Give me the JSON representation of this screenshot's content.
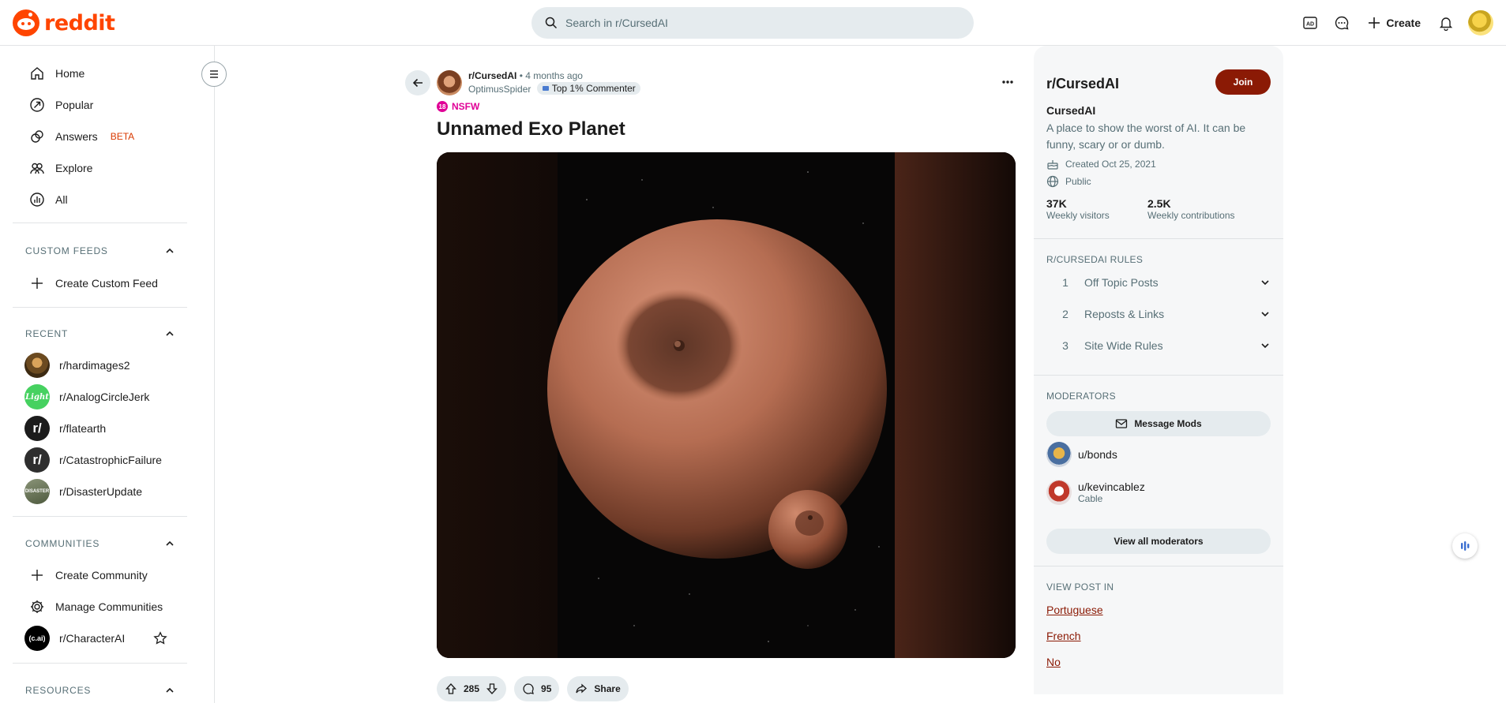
{
  "header": {
    "brand": "reddit",
    "search_placeholder": "Search in r/CursedAI",
    "create_label": "Create"
  },
  "sidebar": {
    "nav": [
      {
        "label": "Home",
        "icon": "home-icon"
      },
      {
        "label": "Popular",
        "icon": "popular-icon"
      },
      {
        "label": "Answers",
        "badge": "BETA",
        "icon": "answers-icon"
      },
      {
        "label": "Explore",
        "icon": "explore-icon"
      },
      {
        "label": "All",
        "icon": "all-icon"
      }
    ],
    "custom_feeds": {
      "title": "CUSTOM FEEDS",
      "create": "Create Custom Feed"
    },
    "recent": {
      "title": "RECENT",
      "items": [
        {
          "label": "r/hardimages2",
          "color": "#7a5a2e"
        },
        {
          "label": "r/AnalogCircleJerk",
          "color": "#46d160",
          "icon_text": "Light"
        },
        {
          "label": "r/flatearth",
          "color": "#1c1c1c",
          "icon_text": "r/"
        },
        {
          "label": "r/CatastrophicFailure",
          "color": "#2a2a2a",
          "icon_text": "r/"
        },
        {
          "label": "r/DisasterUpdate",
          "color": "#5b6b4e",
          "icon_text": "DISASTER"
        }
      ]
    },
    "communities": {
      "title": "COMMUNITIES",
      "create": "Create Community",
      "manage": "Manage Communities",
      "items": [
        {
          "label": "r/CharacterAI",
          "icon_text": "(c.ai)"
        }
      ]
    },
    "resources": {
      "title": "RESOURCES"
    }
  },
  "post": {
    "subreddit": "r/CursedAI",
    "time": "• 4 months ago",
    "author": "OptimusSpider",
    "author_flair": "Top 1% Commenter",
    "nsfw_badge": "18",
    "nsfw_label": "NSFW",
    "title": "Unnamed Exo Planet",
    "votes": "285",
    "comments": "95",
    "share_label": "Share"
  },
  "about": {
    "title": "r/CursedAI",
    "join_label": "Join",
    "name": "CursedAI",
    "description": "A place to show the worst of AI. It can be funny, scary or or dumb.",
    "created": "Created Oct 25, 2021",
    "visibility": "Public",
    "stats": [
      {
        "value": "37K",
        "label": "Weekly visitors"
      },
      {
        "value": "2.5K",
        "label": "Weekly contributions"
      }
    ],
    "rules_title": "R/CURSEDAI RULES",
    "rules": [
      {
        "num": "1",
        "text": "Off Topic Posts"
      },
      {
        "num": "2",
        "text": "Reposts & Links"
      },
      {
        "num": "3",
        "text": "Site Wide Rules"
      }
    ],
    "moderators_title": "MODERATORS",
    "message_mods": "Message Mods",
    "moderators": [
      {
        "name": "u/bonds",
        "flair": ""
      },
      {
        "name": "u/kevincablez",
        "flair": "Cable"
      }
    ],
    "view_all_mods": "View all moderators",
    "view_post_in_title": "VIEW POST IN",
    "languages": [
      "Portuguese",
      "French",
      "No"
    ]
  },
  "colors": {
    "brand": "#ff4500",
    "join": "#8b1a05",
    "nsfw": "#e00096",
    "beta": "#d93900"
  }
}
